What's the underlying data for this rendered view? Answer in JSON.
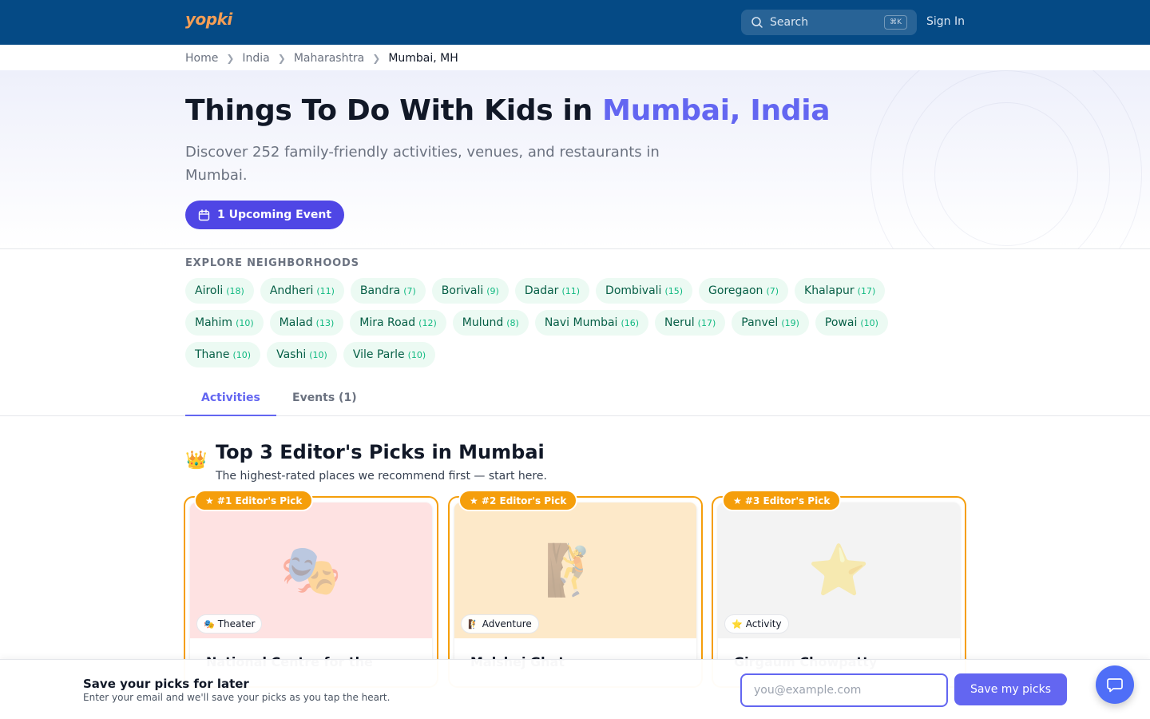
{
  "nav": {
    "logo_text": "yopki",
    "search_placeholder": "Search",
    "search_shortcut": "⌘K",
    "signin_label": "Sign In"
  },
  "breadcrumb": [
    "Home",
    "India",
    "Maharashtra",
    "Mumbai, MH"
  ],
  "hero": {
    "title_prefix": "Things To Do With Kids in ",
    "title_accent": "Mumbai, India",
    "subtitle": "Discover 252 family-friendly activities, venues, and restaurants in Mumbai.",
    "event_button_label": "1 Upcoming Event"
  },
  "neighborhoods": {
    "title": "EXPLORE NEIGHBORHOODS",
    "items": [
      {
        "name": "Airoli",
        "count": "(18)"
      },
      {
        "name": "Andheri",
        "count": "(11)"
      },
      {
        "name": "Bandra",
        "count": "(7)"
      },
      {
        "name": "Borivali",
        "count": "(9)"
      },
      {
        "name": "Dadar",
        "count": "(11)"
      },
      {
        "name": "Dombivali",
        "count": "(15)"
      },
      {
        "name": "Goregaon",
        "count": "(7)"
      },
      {
        "name": "Khalapur",
        "count": "(17)"
      },
      {
        "name": "Mahim",
        "count": "(10)"
      },
      {
        "name": "Malad",
        "count": "(13)"
      },
      {
        "name": "Mira Road",
        "count": "(12)"
      },
      {
        "name": "Mulund",
        "count": "(8)"
      },
      {
        "name": "Navi Mumbai",
        "count": "(16)"
      },
      {
        "name": "Nerul",
        "count": "(17)"
      },
      {
        "name": "Panvel",
        "count": "(19)"
      },
      {
        "name": "Powai",
        "count": "(10)"
      },
      {
        "name": "Thane",
        "count": "(10)"
      },
      {
        "name": "Vashi",
        "count": "(10)"
      },
      {
        "name": "Vile Parle",
        "count": "(10)"
      }
    ]
  },
  "tabs": [
    {
      "label": "Activities",
      "active": true
    },
    {
      "label": "Events (1)",
      "active": false
    }
  ],
  "picks": {
    "crown_icon": "👑",
    "title": "Top 3 Editor's Picks in Mumbai",
    "subtitle": "The highest-rated places we recommend first — start here.",
    "cards": [
      {
        "badge": "★ #1 Editor's Pick",
        "category": "Theater",
        "category_icon": "🎭",
        "image_icon": "🎭",
        "bg": "#fee2e2",
        "title": "National Centre for the"
      },
      {
        "badge": "★ #2 Editor's Pick",
        "category": "Adventure",
        "category_icon": "🧗",
        "image_icon": "🧗",
        "bg": "#fde9c9",
        "title": "Malshej Ghat"
      },
      {
        "badge": "★ #3 Editor's Pick",
        "category": "Activity",
        "category_icon": "⭐",
        "image_icon": "⭐",
        "bg": "#f3f3f3",
        "title": "Girgaum Chowpatty"
      }
    ]
  },
  "savebar": {
    "title": "Save your picks for later",
    "subtitle": "Enter your email and we'll save your picks as you tap the heart.",
    "email_placeholder": "you@example.com",
    "button_label": "Save my picks"
  },
  "colors": {
    "nav_bg": "#054a85",
    "accent": "#6366f1",
    "event_button": "#4f46e5",
    "pick_gold": "#f59e0b",
    "chip_bg": "#ecfaf3"
  }
}
